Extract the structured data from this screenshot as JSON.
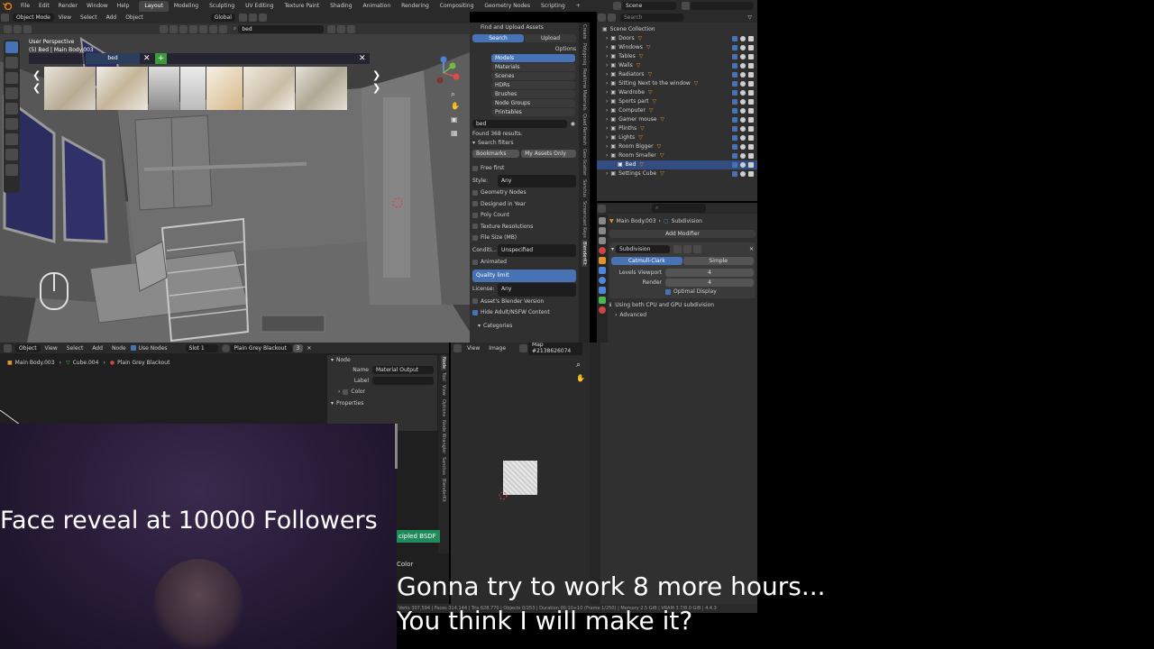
{
  "topbar": {
    "menus": [
      "File",
      "Edit",
      "Render",
      "Window",
      "Help"
    ],
    "workspaces": [
      "Layout",
      "Modeling",
      "Sculpting",
      "UV Editing",
      "Texture Paint",
      "Shading",
      "Animation",
      "Rendering",
      "Compositing",
      "Geometry Nodes",
      "Scripting"
    ],
    "active_workspace": "Layout",
    "scene": "Scene"
  },
  "viewport": {
    "mode": "Object Mode",
    "menus": [
      "View",
      "Select",
      "Add",
      "Object"
    ],
    "transform": "Global",
    "search_value": "bed",
    "info_line1": "User Perspective",
    "info_line2": "(5) Bed | Main Body.003",
    "asset_search": "bed"
  },
  "asset_panel": {
    "header": "Find and Upload Assets",
    "tab_search": "Search",
    "tab_upload": "Upload",
    "options": "Options",
    "categories": [
      "Models",
      "Materials",
      "Scenes",
      "HDRs",
      "Brushes",
      "Node Groups",
      "Printables"
    ],
    "search_value": "bed",
    "found": "Found 368 results.",
    "search_filters": "Search filters",
    "bookmarks": "Bookmarks",
    "my_assets": "My Assets Only",
    "free_first": "Free first",
    "style_label": "Style:",
    "style_value": "Any",
    "filters": [
      "Geometry Nodes",
      "Designed in Year",
      "Poly Count",
      "Texture Resolutions",
      "File Size (MB)"
    ],
    "condition_label": "Conditi...",
    "condition_value": "Unspecified",
    "animated": "Animated",
    "quality": "Quality limit",
    "license_label": "License:",
    "license_value": "Any",
    "blender_version": "Asset's Blender Version",
    "hide_adult": "Hide Adult/NSFW Content",
    "categories_label": "Categories"
  },
  "side_tabs": [
    "Create",
    "Polygoniq",
    "Realtime Materials",
    "Quad Remesh",
    "Geo-Scatter",
    "Sanctus",
    "Screencast Keys",
    "BlenderKit"
  ],
  "outliner": {
    "search_placeholder": "Search",
    "filter": "n",
    "root": "Scene Collection",
    "items": [
      "Doors",
      "Windows",
      "Tables",
      "Walls",
      "Radiators",
      "Sitting Next to the window",
      "Wardrobe",
      "Sports part",
      "Computer",
      "Gamer mouse",
      "Plinths",
      "Lights",
      "Room Bigger",
      "Room Smaller",
      "Bed",
      "Settings Cube"
    ],
    "selected": "Bed"
  },
  "properties": {
    "breadcrumb_obj": "Main Body.003",
    "breadcrumb_mod": "Subdivision",
    "add_modifier": "Add Modifier",
    "modifier_name": "Subdivision",
    "mode_a": "Catmull-Clark",
    "mode_b": "Simple",
    "levels_label": "Levels Viewport",
    "levels_value": "4",
    "render_label": "Render",
    "render_value": "4",
    "optimal": "Optimal Display",
    "info": "Using both CPU and GPU subdivision",
    "advanced": "Advanced"
  },
  "node_editor": {
    "type": "Object",
    "menus": [
      "View",
      "Select",
      "Add",
      "Node"
    ],
    "use_nodes": "Use Nodes",
    "slot": "Slot 1",
    "material": "Plain Grey Blackout",
    "users": "3",
    "crumb1": "Main Body.003",
    "crumb2": "Cube.004",
    "crumb3": "Plain Grey Blackout",
    "node_header": "Node",
    "name_label": "Name",
    "name_value": "Material Output",
    "label_label": "Label",
    "color_label": "Color",
    "properties_label": "Properties",
    "all_label": "All",
    "tabs": [
      "Node",
      "Tool",
      "View",
      "Options",
      "Node Wrangler",
      "Sanctus",
      "BlenderKit"
    ],
    "bsdf_label": "cipled BSDF",
    "color_socket": "Color"
  },
  "image_editor": {
    "menus": [
      "View",
      "Image"
    ],
    "image_name": "Map #2138626074"
  },
  "statusbar": {
    "text": "Verts 307,594 | Faces 314,144 | Tris 628,770 | Objects 0/253 | Duration 00:10+10 (Frame 1/250) | Memory 2.5 GiB | VRAM 3.7/8.0 GiB | 4.4.3"
  },
  "overlay": {
    "face_reveal": "Face reveal at 10000 Followers",
    "line1": "Gonna try to work 8 more hours...",
    "line2": "You think I will make it?"
  }
}
